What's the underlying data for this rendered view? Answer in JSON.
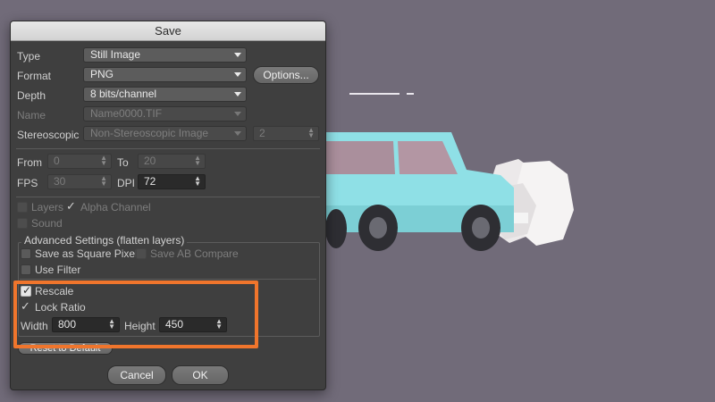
{
  "dialog": {
    "title": "Save",
    "type": {
      "label": "Type",
      "value": "Still Image"
    },
    "format": {
      "label": "Format",
      "value": "PNG",
      "options_button": "Options..."
    },
    "depth": {
      "label": "Depth",
      "value": "8 bits/channel"
    },
    "name": {
      "label": "Name",
      "value": "Name0000.TIF"
    },
    "stereoscopic": {
      "label": "Stereoscopic",
      "value": "Non-Stereoscopic Image",
      "count": "2"
    },
    "from": {
      "label": "From",
      "value": "0"
    },
    "to": {
      "label": "To",
      "value": "20"
    },
    "fps": {
      "label": "FPS",
      "value": "30"
    },
    "dpi": {
      "label": "DPI",
      "value": "72"
    },
    "layers": {
      "label": "Layers",
      "checked": false
    },
    "alpha_channel": {
      "label": "Alpha Channel",
      "checked": true
    },
    "sound": {
      "label": "Sound",
      "checked": false
    },
    "advanced": {
      "title": "Advanced Settings (flatten layers)",
      "square_pixel": {
        "label": "Save as Square Pixel",
        "checked": false
      },
      "ab_compare": {
        "label": "Save AB Compare",
        "checked": false
      },
      "use_filter": {
        "label": "Use Filter",
        "checked": false
      },
      "rescale": {
        "label": "Rescale",
        "checked": true
      },
      "lock_ratio": {
        "label": "Lock Ratio",
        "checked": true
      },
      "width": {
        "label": "Width",
        "value": "800"
      },
      "height": {
        "label": "Height",
        "value": "450"
      }
    },
    "reset_button": "Reset to Default",
    "cancel_button": "Cancel",
    "ok_button": "OK"
  },
  "colors": {
    "highlight": "#f0752c",
    "viewport_bg": "#716b79",
    "car_body": "#8fe0e6",
    "dust": "#f2f0f0"
  },
  "icons": [
    "caret-down-icon",
    "stepper-icon",
    "checkmark-icon"
  ]
}
